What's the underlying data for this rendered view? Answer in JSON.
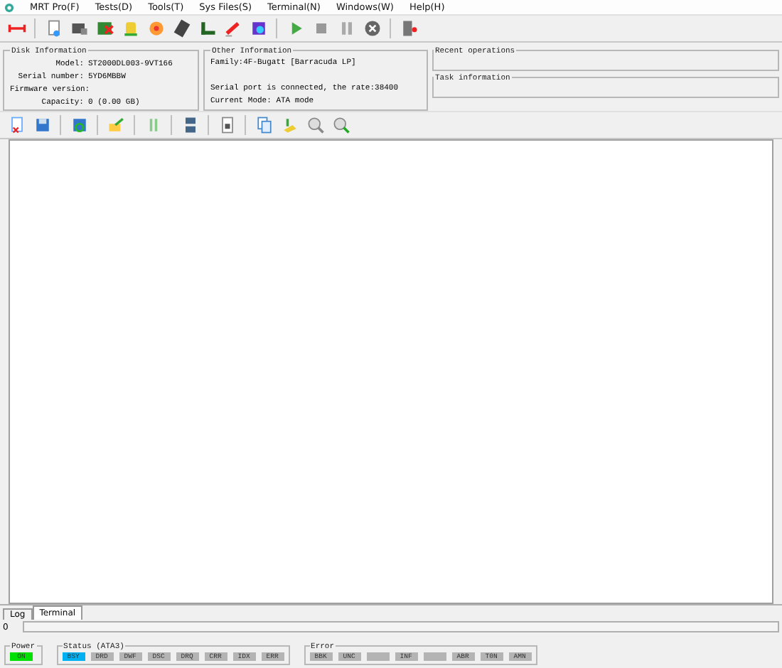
{
  "menu": [
    "MRT Pro(F)",
    "Tests(D)",
    "Tools(T)",
    "Sys Files(S)",
    "Terminal(N)",
    "Windows(W)",
    "Help(H)"
  ],
  "disk_info": {
    "title": "Disk Information",
    "fields": [
      {
        "label": "Model:",
        "value": "ST2000DL003-9VT166"
      },
      {
        "label": "Serial number:",
        "value": "5YD6MBBW"
      },
      {
        "label": "Firmware version:"
      },
      {
        "label": "Capacity:",
        "value": "0 (0.00 GB)"
      }
    ]
  },
  "other_info": {
    "title": "Other Information",
    "top_lines": [
      "Family:4F-Bugatt [Barracuda LP]"
    ],
    "bottom_lines": [
      "Serial port is connected, the rate:38400",
      "Current Mode: ATA mode"
    ]
  },
  "recent": {
    "title": "Recent operations"
  },
  "task": {
    "title": "Task information"
  },
  "tabs": [
    {
      "label": "Log",
      "selected": false
    },
    {
      "label": "Terminal",
      "selected": true
    }
  ],
  "progress": {
    "reading": "0"
  },
  "power": {
    "title": "Power",
    "leds": [
      {
        "label": "ON",
        "color": "#00e000"
      }
    ]
  },
  "status": {
    "title": "Status (ATA3)",
    "leds": [
      {
        "label": "BSY",
        "color": "#00b0f0"
      },
      {
        "label": "DRD",
        "color": "#b4b4b4"
      },
      {
        "label": "DWF",
        "color": "#b4b4b4"
      },
      {
        "label": "DSC",
        "color": "#b4b4b4"
      },
      {
        "label": "DRQ",
        "color": "#b4b4b4"
      },
      {
        "label": "CRR",
        "color": "#b4b4b4"
      },
      {
        "label": "IDX",
        "color": "#b4b4b4"
      },
      {
        "label": "ERR",
        "color": "#b4b4b4"
      }
    ]
  },
  "error": {
    "title": "Error",
    "leds": [
      {
        "label": "BBK",
        "color": "#b4b4b4"
      },
      {
        "label": "UNC",
        "color": "#b4b4b4"
      },
      {
        "color": "#b4b4b4"
      },
      {
        "label": "INF",
        "color": "#b4b4b4"
      },
      {
        "color": "#b4b4b4"
      },
      {
        "label": "ABR",
        "color": "#b4b4b4"
      },
      {
        "label": "T0N",
        "color": "#b4b4b4"
      },
      {
        "label": "AMN",
        "color": "#b4b4b4"
      }
    ]
  }
}
